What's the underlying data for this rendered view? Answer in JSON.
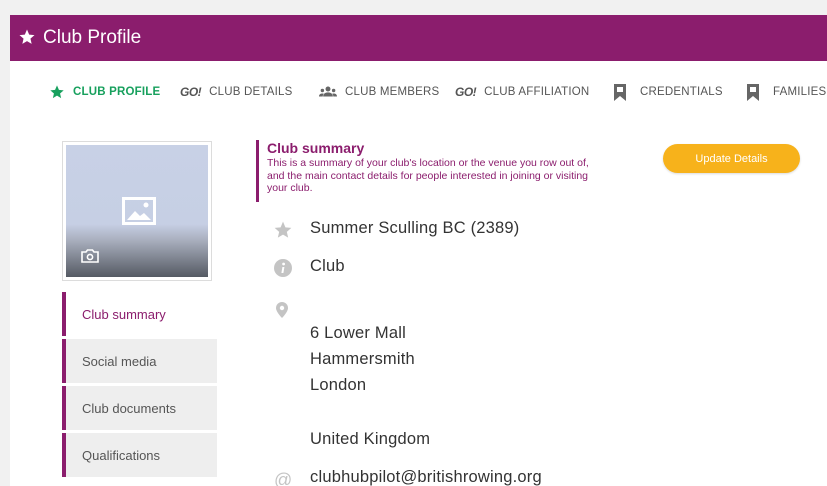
{
  "header": {
    "title": "Club Profile",
    "icon": "star-icon"
  },
  "tabs": [
    {
      "label": "CLUB PROFILE",
      "icon": "star-icon",
      "active": true
    },
    {
      "label": "CLUB DETAILS",
      "icon_text": "GO!",
      "active": false
    },
    {
      "label": "CLUB MEMBERS",
      "icon": "users-icon",
      "active": false
    },
    {
      "label": "CLUB AFFILIATION",
      "icon_text": "GO!",
      "active": false
    },
    {
      "label": "CREDENTIALS",
      "icon": "bookmark-icon",
      "active": false
    },
    {
      "label": "FAMILIES",
      "icon": "bookmark-icon",
      "active": false
    }
  ],
  "sidebar": {
    "items": [
      {
        "label": "Club summary",
        "active": true
      },
      {
        "label": "Social media",
        "active": false
      },
      {
        "label": "Club documents",
        "active": false
      },
      {
        "label": "Qualifications",
        "active": false
      }
    ]
  },
  "summary": {
    "heading": "Club summary",
    "description": "This is a summary of your club's location or the venue you row out of, and the main contact details for people interested in joining or visiting your club.",
    "update_label": "Update Details"
  },
  "club": {
    "name": "Summer Sculling BC (2389)",
    "type": "Club",
    "address_line1": "6 Lower Mall",
    "address_line2": "Hammersmith",
    "address_line3": "London",
    "country": "United Kingdom",
    "email": "clubhubpilot@britishrowing.org"
  },
  "colors": {
    "brand": "#8b1d6d",
    "active_tab": "#17a05d",
    "button": "#f7b21b"
  }
}
